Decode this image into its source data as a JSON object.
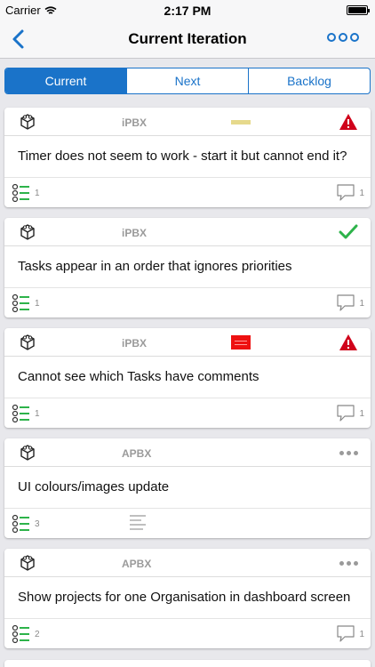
{
  "status_bar": {
    "carrier": "Carrier",
    "time": "2:17 PM"
  },
  "nav": {
    "title": "Current Iteration"
  },
  "tabs": [
    {
      "label": "Current",
      "active": true
    },
    {
      "label": "Next",
      "active": false
    },
    {
      "label": "Backlog",
      "active": false
    }
  ],
  "cards": [
    {
      "project": "iPBX",
      "priority": "yellow",
      "status": "warning-icon",
      "text": "Timer does not seem to work - start it but cannot end it?",
      "tasks": "1",
      "comments": "1",
      "has_description": false,
      "has_comment": true
    },
    {
      "project": "iPBX",
      "priority": "none",
      "status": "checkmark-icon",
      "text": "Tasks appear in an order that ignores priorities",
      "tasks": "1",
      "comments": "1",
      "has_description": false,
      "has_comment": true
    },
    {
      "project": "iPBX",
      "priority": "red",
      "status": "warning-icon",
      "text": "Cannot see which Tasks have comments",
      "tasks": "1",
      "comments": "1",
      "has_description": false,
      "has_comment": true
    },
    {
      "project": "APBX",
      "priority": "none",
      "status": "ellipsis-icon",
      "text": "UI colours/images update",
      "tasks": "3",
      "comments": "",
      "has_description": true,
      "has_comment": false
    },
    {
      "project": "APBX",
      "priority": "none",
      "status": "ellipsis-icon",
      "text": "Show projects for one Organisation in dashboard screen",
      "tasks": "2",
      "comments": "1",
      "has_description": false,
      "has_comment": true
    }
  ],
  "colors": {
    "accent": "#1a73c9",
    "warning": "#d0021b",
    "success": "#2db34a"
  }
}
